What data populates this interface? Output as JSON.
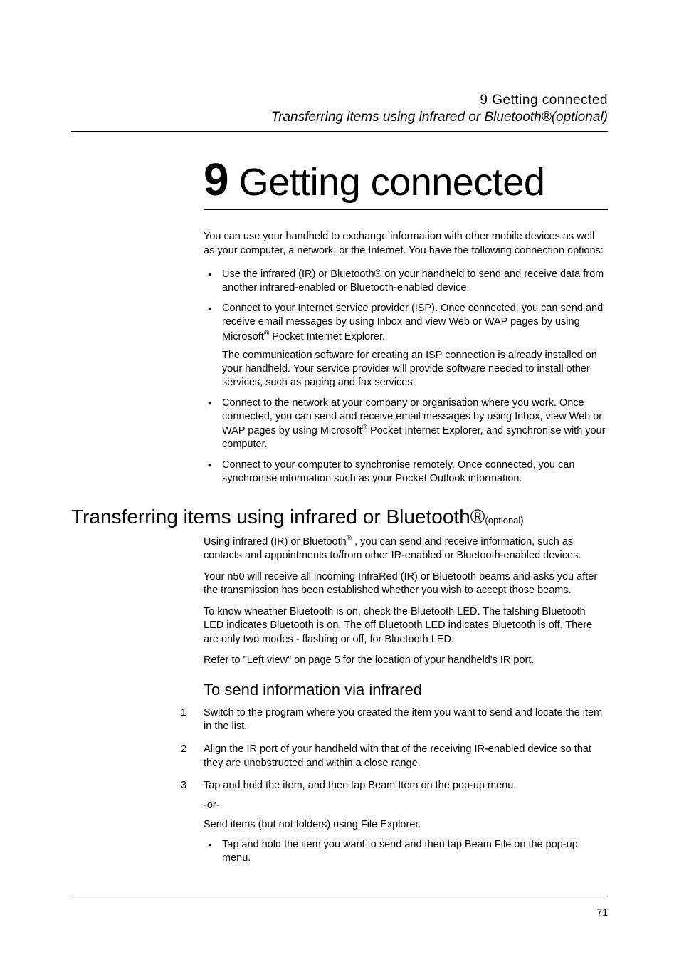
{
  "header": {
    "chapter": "9 Getting connected",
    "section": "Transferring items using infrared or Bluetooth®(optional)"
  },
  "chapter": {
    "number": "9",
    "title": "Getting connected"
  },
  "intro": "You can use your handheld to exchange information with other mobile devices as well as your computer, a network, or the Internet. You have the following connection options:",
  "bullets": [
    {
      "text": "Use the infrared (IR) or Bluetooth® on your handheld to send and receive data from another infrared-enabled or Bluetooth-enabled device."
    },
    {
      "text_pre": "Connect to your Internet service provider (ISP). Once connected, you can send and receive email messages by using Inbox and view Web or WAP pages by using Microsoft",
      "text_post": " Pocket Internet Explorer.",
      "sub": "The communication software for creating an ISP connection is already installed on your handheld. Your service provider will provide software needed to install other services, such as paging and fax services."
    },
    {
      "text_pre": "Connect to the network at your company or organisation where you work. Once connected, you can send and receive email messages by using Inbox, view Web or WAP pages by using Microsoft",
      "text_post": " Pocket Internet Explorer, and synchronise with your computer."
    },
    {
      "text": "Connect to your computer to synchronise remotely. Once connected, you can synchronise information such as your Pocket Outlook information."
    }
  ],
  "section": {
    "heading": "Transferring items using infrared or Bluetooth®",
    "optional": "(optional)",
    "para1_pre": "Using infrared (IR) or Bluetooth",
    "para1_post": " , you can send and receive information, such as contacts and appointments to/from other IR-enabled or Bluetooth-enabled devices.",
    "para2": "Your n50 will receive all incoming InfraRed (IR) or Bluetooth beams and asks you after the transmission has been established whether you wish to accept those beams.",
    "para3": "To know wheather Bluetooth is on, check the Bluetooth LED. The falshing Bluetooth LED indicates Bluetooth is on. The off Bluetooth LED indicates Bluetooth is off. There are only two modes - flashing or off, for Bluetooth LED.",
    "para4": "Refer to \"Left view\" on page 5 for the location of your handheld's IR port."
  },
  "subsection": {
    "heading": "To send information via infrared",
    "steps": [
      {
        "num": "1",
        "text": "Switch to the program where you created the item you want to send and locate the item in the list."
      },
      {
        "num": "2",
        "text": "Align the IR port of your handheld with that of the receiving IR-enabled device so that they are unobstructed and within a close range."
      },
      {
        "num": "3",
        "text": "Tap and hold the item, and then tap Beam Item on the pop-up menu.",
        "or": "-or-",
        "sub": "Send items (but not folders) using File Explorer.",
        "nested": "Tap and hold the item you want to send and then tap Beam File on the pop-up menu."
      }
    ]
  },
  "pageNumber": "71"
}
